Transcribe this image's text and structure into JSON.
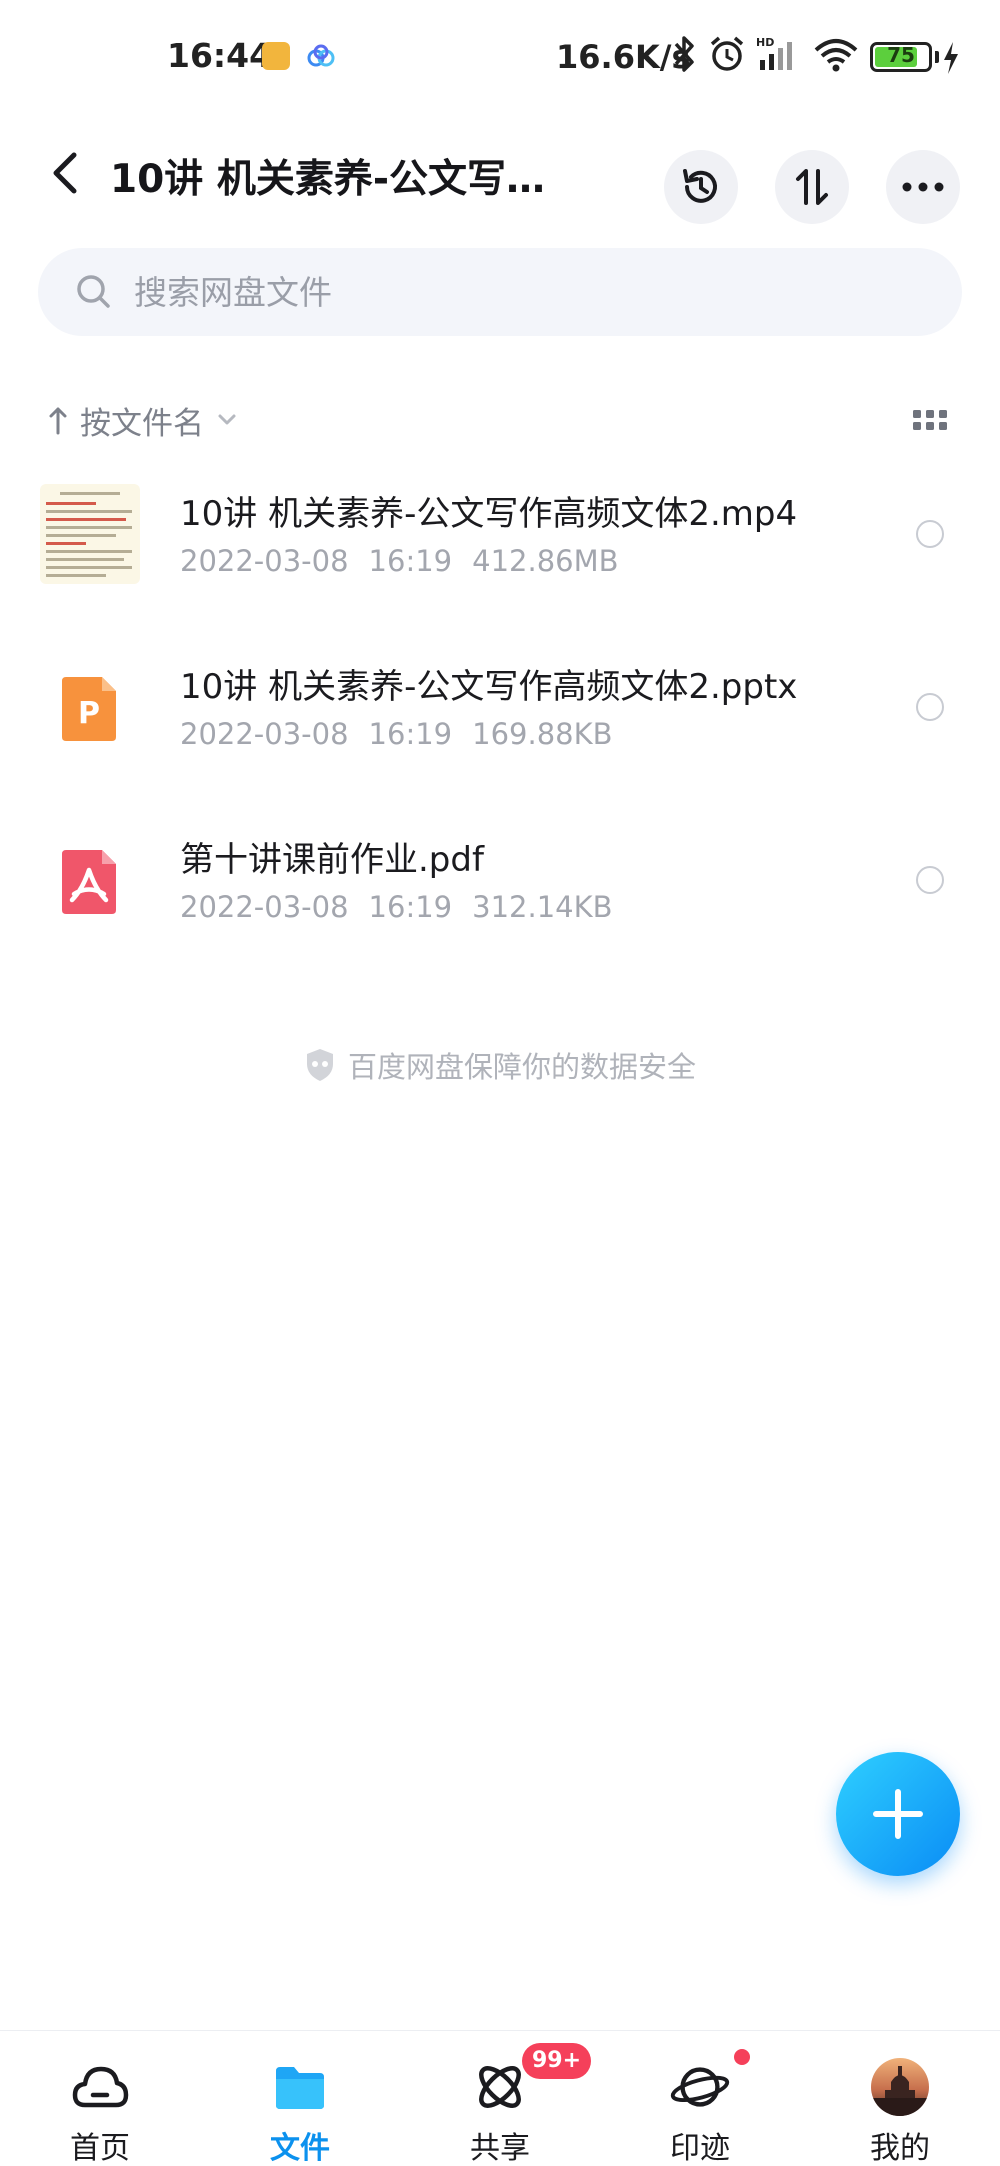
{
  "status_bar": {
    "time": "16:44",
    "network_speed": "16.6K/s",
    "battery_level": "75",
    "icons": [
      "app-notification-icon",
      "baidu-cloud-icon",
      "bluetooth-icon",
      "alarm-icon",
      "signal-hd-icon",
      "wifi-icon",
      "battery-icon",
      "charging-icon"
    ]
  },
  "header": {
    "title": "10讲 机关素养-公文写…",
    "back_icon": "chevron-left-icon",
    "actions": [
      "history-icon",
      "transfer-icon",
      "more-icon"
    ]
  },
  "search": {
    "placeholder": "搜索网盘文件"
  },
  "sort": {
    "label": "按文件名",
    "view_icon": "grid-view-icon"
  },
  "files": [
    {
      "name": "10讲 机关素养-公文写作高频文体2.mp4",
      "date": "2022-03-08",
      "time": "16:19",
      "size": "412.86MB",
      "type": "video"
    },
    {
      "name": "10讲 机关素养-公文写作高频文体2.pptx",
      "date": "2022-03-08",
      "time": "16:19",
      "size": "169.88KB",
      "type": "pptx"
    },
    {
      "name": "第十讲课前作业.pdf",
      "date": "2022-03-08",
      "time": "16:19",
      "size": "312.14KB",
      "type": "pdf"
    }
  ],
  "safety_note": "百度网盘保障你的数据安全",
  "nav": {
    "items": [
      {
        "label": "首页",
        "icon": "cloud-home-icon"
      },
      {
        "label": "文件",
        "icon": "folder-icon"
      },
      {
        "label": "共享",
        "icon": "share-atom-icon",
        "badge": "99+"
      },
      {
        "label": "印迹",
        "icon": "planet-icon"
      },
      {
        "label": "我的",
        "icon": "avatar"
      }
    ],
    "active": "文件"
  },
  "colors": {
    "accent": "#0b91ee",
    "badge": "#f5405a",
    "pptx": "#f7923d",
    "pdf": "#f0566a"
  }
}
